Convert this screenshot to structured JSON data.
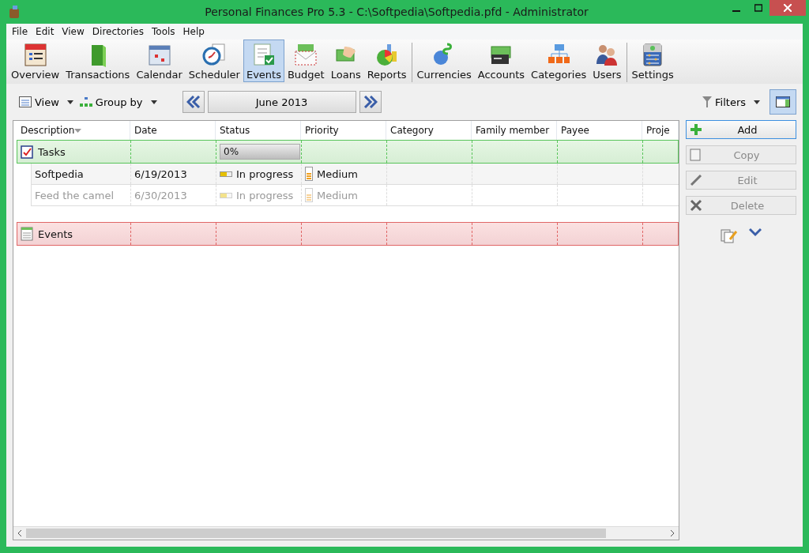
{
  "window": {
    "title": "Personal Finances Pro 5.3 - C:\\Softpedia\\Softpedia.pfd - Administrator"
  },
  "menu": [
    "File",
    "Edit",
    "View",
    "Directories",
    "Tools",
    "Help"
  ],
  "toolbar_groups": [
    {
      "items": [
        {
          "label": "Overview",
          "selected": false
        },
        {
          "label": "Transactions",
          "selected": false
        },
        {
          "label": "Calendar",
          "selected": false
        },
        {
          "label": "Scheduler",
          "selected": false
        },
        {
          "label": "Events",
          "selected": true
        },
        {
          "label": "Budget",
          "selected": false
        },
        {
          "label": "Loans",
          "selected": false
        },
        {
          "label": "Reports",
          "selected": false
        }
      ]
    },
    {
      "items": [
        {
          "label": "Currencies",
          "selected": false
        },
        {
          "label": "Accounts",
          "selected": false
        },
        {
          "label": "Categories",
          "selected": false
        },
        {
          "label": "Users",
          "selected": false
        }
      ]
    },
    {
      "items": [
        {
          "label": "Settings",
          "selected": false
        }
      ]
    }
  ],
  "subbar": {
    "view": "View",
    "group_by": "Group by",
    "period": "June 2013",
    "filters": "Filters",
    "panel_toggle_on": true
  },
  "table": {
    "columns": [
      "Description",
      "Date",
      "Status",
      "Priority",
      "Category",
      "Family member",
      "Payee",
      "Proje"
    ],
    "groups": [
      {
        "kind": "tasks",
        "label": "Tasks",
        "progress": "0%",
        "level": 0,
        "rows": [
          {
            "description": "Softpedia",
            "date": "6/19/2013",
            "status": "In progress",
            "priority": "Medium",
            "dimmed": false
          },
          {
            "description": "Feed the camel",
            "date": "6/30/2013",
            "status": "In progress",
            "priority": "Medium",
            "dimmed": true
          }
        ]
      },
      {
        "kind": "events",
        "label": "Events"
      }
    ]
  },
  "actions": [
    {
      "label": "Add",
      "disabled": false
    },
    {
      "label": "Copy",
      "disabled": true
    },
    {
      "label": "Edit",
      "disabled": true
    },
    {
      "label": "Delete",
      "disabled": true
    }
  ]
}
